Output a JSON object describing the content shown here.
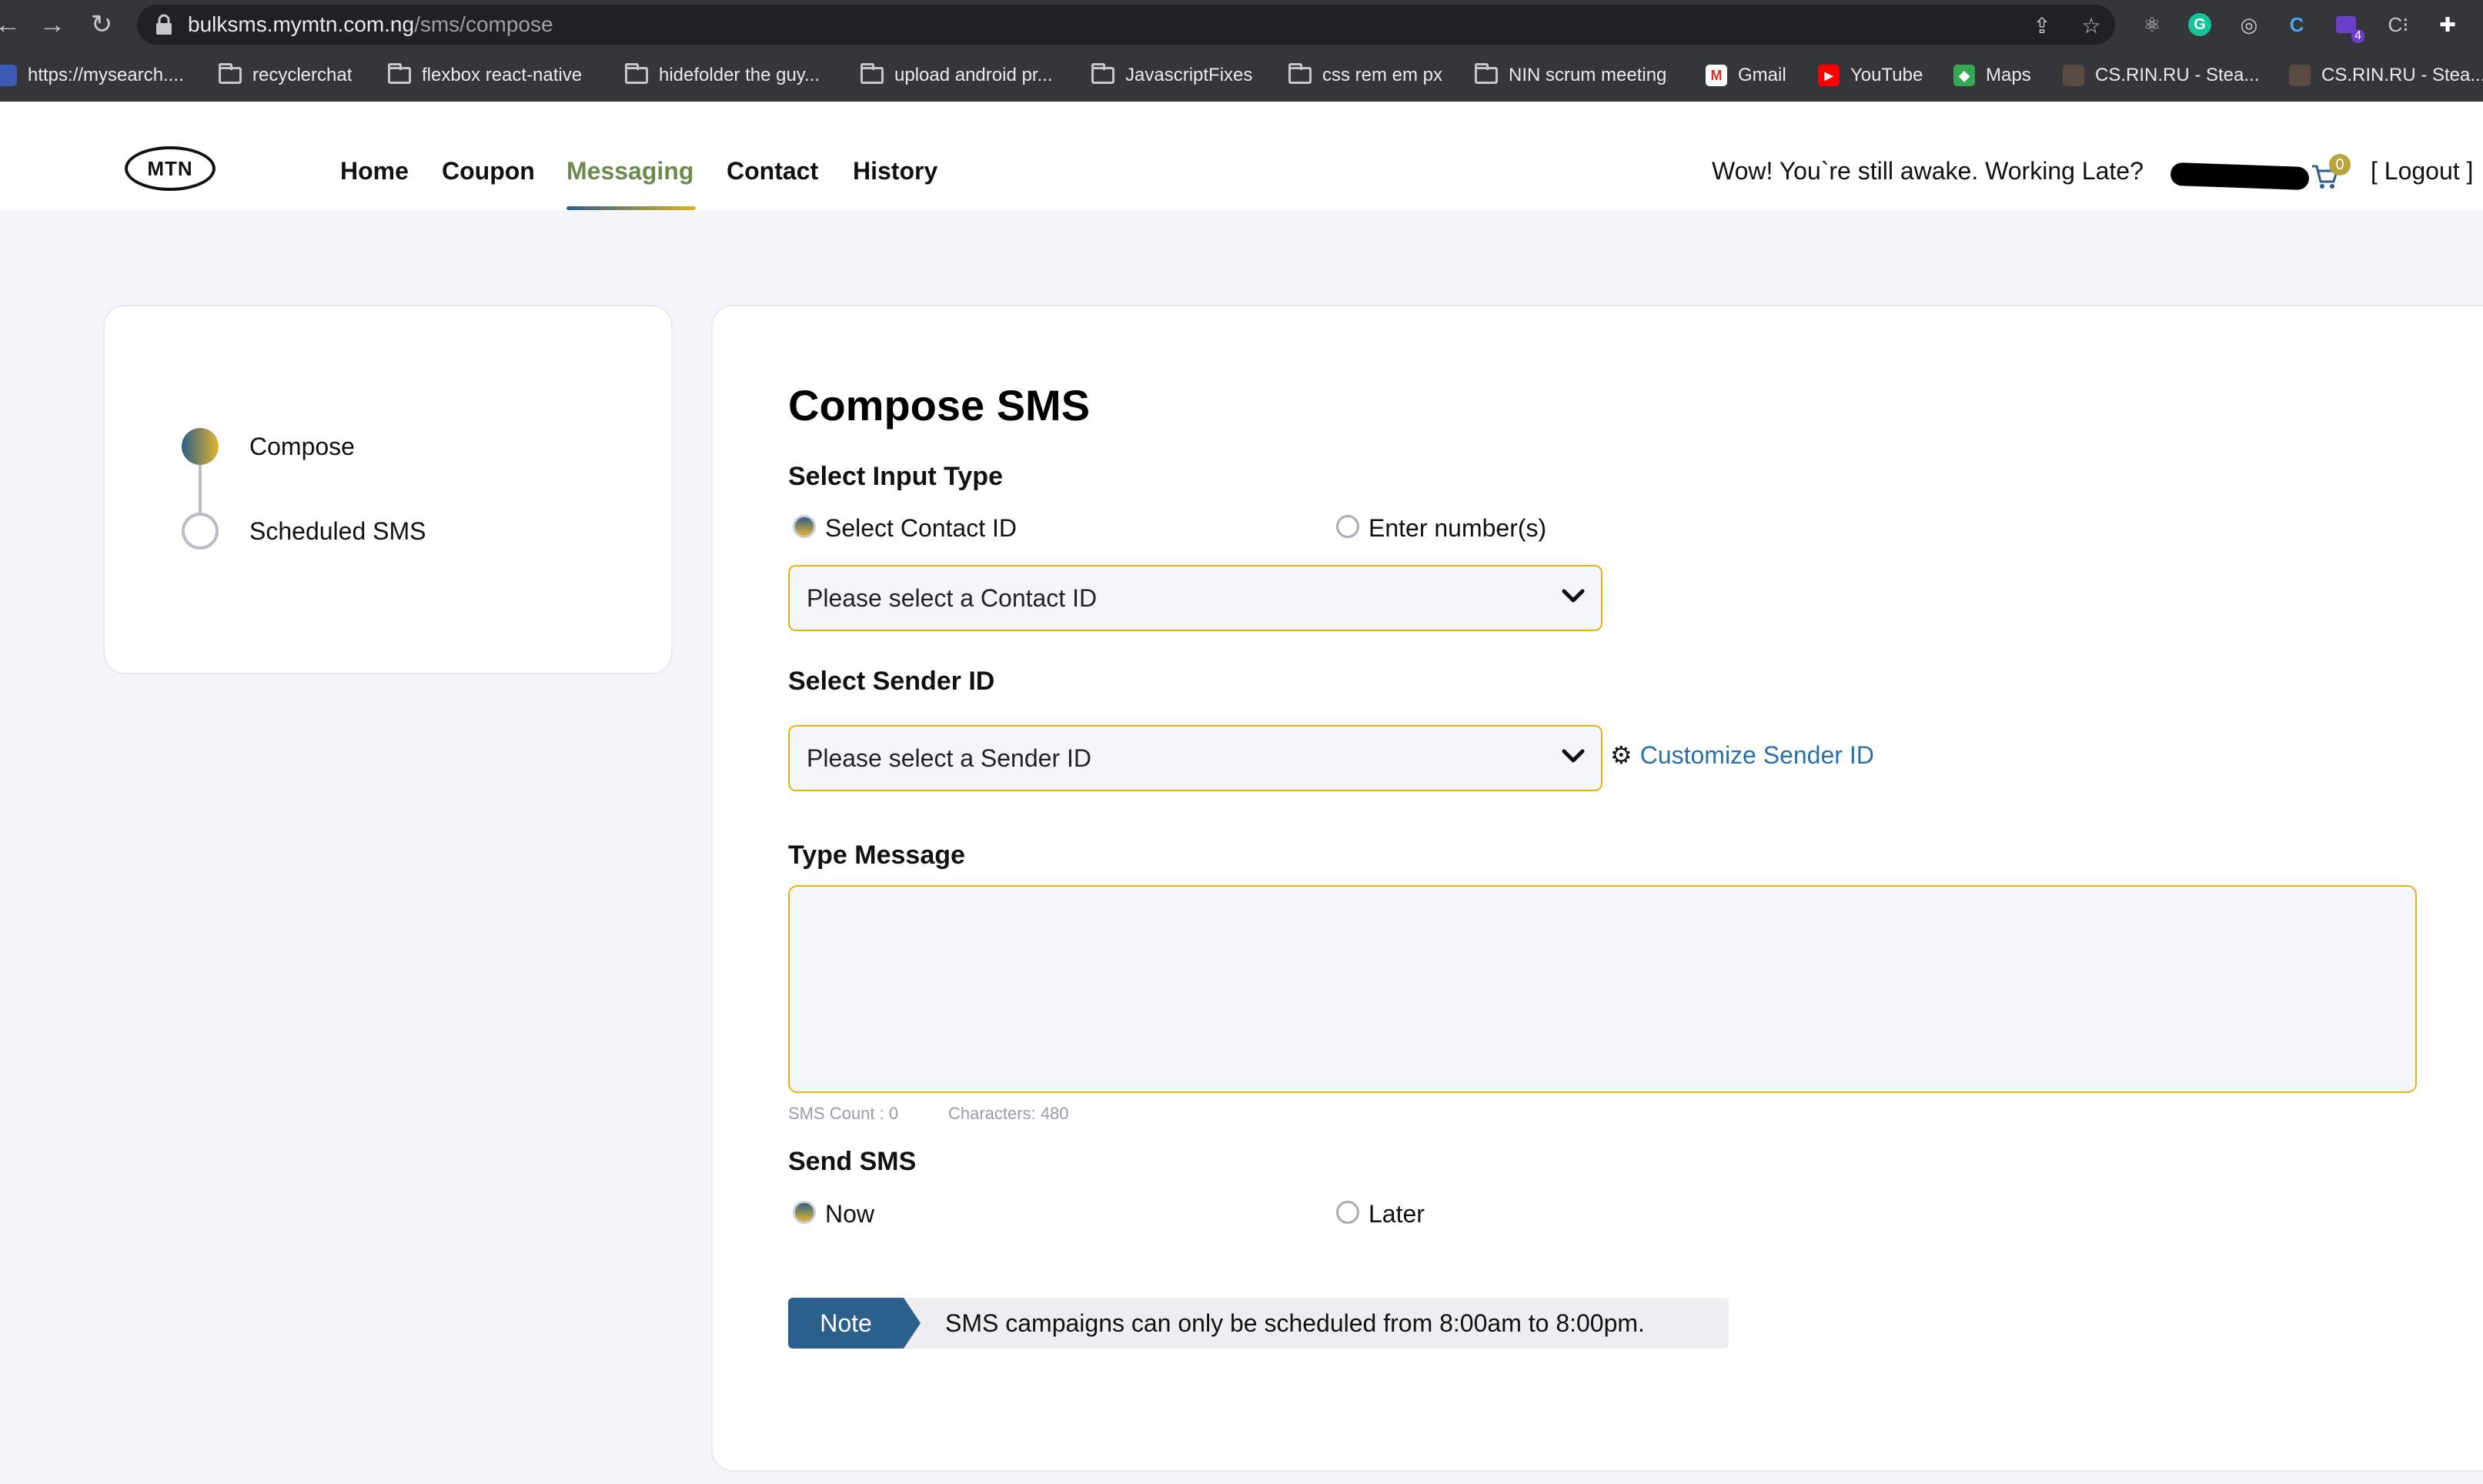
{
  "browser": {
    "url_domain": "bulksms.mymtn.com.ng",
    "url_path": "/sms/compose",
    "extension_badge": "4",
    "bookmarks": [
      {
        "label": "https://mysearch....",
        "type": "favicon-mixed"
      },
      {
        "label": "recyclerchat",
        "type": "folder"
      },
      {
        "label": "flexbox react-native",
        "type": "folder"
      },
      {
        "label": "hidefolder the guy...",
        "type": "folder"
      },
      {
        "label": "upload android pr...",
        "type": "folder"
      },
      {
        "label": "JavascriptFixes",
        "type": "folder"
      },
      {
        "label": "css rem em px",
        "type": "folder"
      },
      {
        "label": "NIN scrum meeting",
        "type": "folder"
      },
      {
        "label": "Gmail",
        "type": "gmail"
      },
      {
        "label": "YouTube",
        "type": "youtube"
      },
      {
        "label": "Maps",
        "type": "maps"
      },
      {
        "label": "CS.RIN.RU - Stea...",
        "type": "site"
      },
      {
        "label": "CS.RIN.RU - Stea...",
        "type": "site"
      }
    ]
  },
  "header": {
    "logo_text": "MTN",
    "nav": [
      {
        "label": "Home",
        "active": false
      },
      {
        "label": "Coupon",
        "active": false
      },
      {
        "label": "Messaging",
        "active": true
      },
      {
        "label": "Contact",
        "active": false
      },
      {
        "label": "History",
        "active": false
      }
    ],
    "greeting": "Wow! You`re still awake. Working Late?",
    "cart_count": "0",
    "logout_label": "[ Logout ]"
  },
  "steps": [
    {
      "label": "Compose",
      "active": true
    },
    {
      "label": "Scheduled SMS",
      "active": false
    }
  ],
  "compose": {
    "title": "Compose SMS",
    "input_type_label": "Select Input Type",
    "input_type_options": [
      {
        "label": "Select Contact ID",
        "selected": true
      },
      {
        "label": "Enter number(s)",
        "selected": false
      }
    ],
    "contact_select_placeholder": "Please select a Contact ID",
    "sender_label": "Select Sender ID",
    "sender_select_placeholder": "Please select a Sender ID",
    "customize_sender_label": "Customize Sender ID",
    "message_label": "Type Message",
    "message_value": "",
    "sms_count_label": "SMS Count : 0",
    "characters_label": "Characters: 480",
    "send_label": "Send SMS",
    "send_options": [
      {
        "label": "Now",
        "selected": true
      },
      {
        "label": "Later",
        "selected": false
      }
    ],
    "note_tag": "Note",
    "note_text": "SMS campaigns can only be scheduled from 8:00am to 8:00pm."
  },
  "colors": {
    "accent_blue": "#2b5f8c",
    "accent_yellow": "#e0b21c",
    "active_nav": "#6e8a4e",
    "link": "#2a6fa8"
  }
}
